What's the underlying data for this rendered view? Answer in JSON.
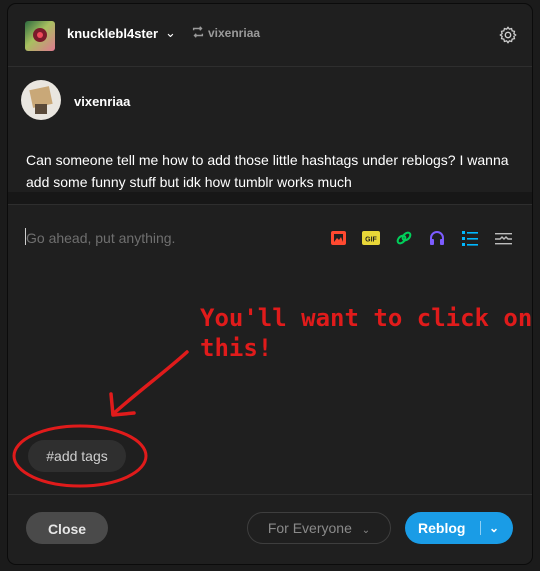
{
  "header": {
    "blog_name": "knucklebl4ster",
    "reblog_source": "vixenriaa"
  },
  "post": {
    "author": "vixenriaa",
    "text": "Can someone tell me how to add those little hashtags under reblogs? I wanna add some funny stuff but idk how tumblr works much"
  },
  "composer": {
    "placeholder": "Go ahead, put anything.",
    "toolbar": [
      "image-icon",
      "gif-icon",
      "link-icon",
      "audio-icon",
      "list-icon",
      "readmore-icon"
    ],
    "gif_label": "GIF"
  },
  "annotation": {
    "line1": "You'll want to click on",
    "line2": "this!"
  },
  "tags": {
    "label": "#add tags"
  },
  "footer": {
    "close_label": "Close",
    "audience_label": "For Everyone",
    "reblog_label": "Reblog"
  },
  "colors": {
    "accent": "#1a9ce6",
    "annotation_red": "#e01b1b"
  }
}
